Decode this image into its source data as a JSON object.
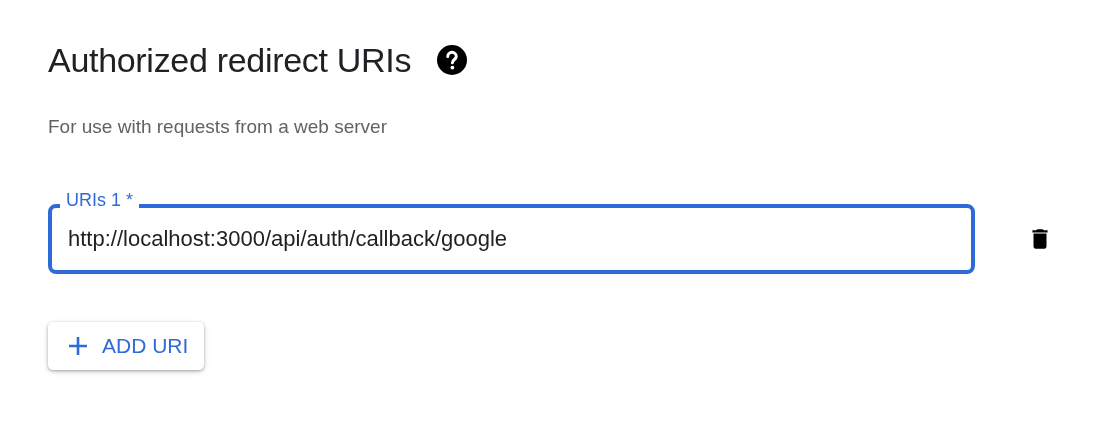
{
  "section": {
    "title": "Authorized redirect URIs",
    "subtitle": "For use with requests from a web server"
  },
  "uris": [
    {
      "label": "URIs 1 *",
      "value": "http://localhost:3000/api/auth/callback/google",
      "focused": true
    }
  ],
  "add_button": {
    "label": "ADD URI"
  }
}
